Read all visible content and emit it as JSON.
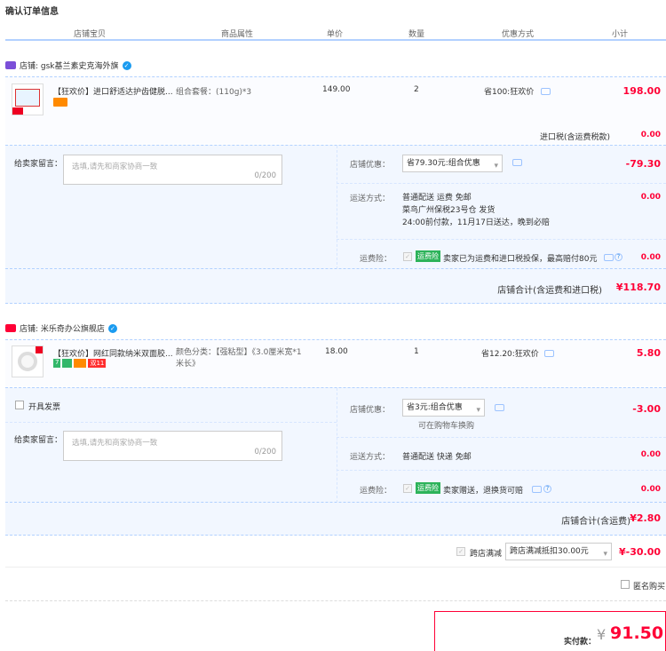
{
  "page": {
    "title": "确认订单信息"
  },
  "columns": [
    "店铺宝贝",
    "商品属性",
    "单价",
    "数量",
    "优惠方式",
    "小计"
  ],
  "shops": [
    {
      "logo": "tmall-global-badge",
      "shop_label": "店铺: gsk基兰素史克海外旗",
      "item": {
        "title": "【狂欢价】进口舒适达护齿健脱...",
        "attr": "组合套餐：(110g)*3",
        "price": "149.00",
        "qty": "2",
        "promo": "省100:狂欢价",
        "subtotal": "198.00"
      },
      "tax_label": "进口税(含运费税款)",
      "tax_value": "0.00",
      "note_label": "给卖家留言：",
      "note_placeholder": "选填,请先和商家协商一致",
      "note_count": "0/200",
      "discount_label": "店铺优惠：",
      "discount_select": "省79.30元:组合优惠",
      "discount_value": "-79.30",
      "shipping_label": "运送方式：",
      "shipping_lines": [
        "普通配送 运费 免邮",
        "菜鸟广州保税23号仓  发货",
        "24:00前付款，11月17日送达，晚到必赔"
      ],
      "shipping_value": "0.00",
      "insurance_label": "运费险：",
      "insurance_tag": "运费险",
      "insurance_text": "卖家已为运费和进口税投保，最高赔付80元",
      "insurance_value": "0.00",
      "total_label": "店铺合计(含运费和进口税)",
      "total_value": "¥118.70"
    },
    {
      "logo": "tmall-badge",
      "shop_label": "店铺: 米乐奇办公旗舰店",
      "item": {
        "title": "【狂欢价】网红同款纳米双面胶...",
        "attr_label": "颜色分类：",
        "attr": "【强粘型】《3.0厘米宽*1米长》",
        "price": "18.00",
        "qty": "1",
        "promo": "省12.20:狂欢价",
        "subtotal": "5.80",
        "tags": [
          "7",
          "双11"
        ]
      },
      "invoice_label": "开具发票",
      "note_label": "给卖家留言：",
      "note_placeholder": "选填,请先和商家协商一致",
      "note_count": "0/200",
      "discount_label": "店铺优惠：",
      "discount_select": "省3元:组合优惠",
      "discount_hint": "可在购物车换购",
      "discount_value": "-3.00",
      "shipping_label": "运送方式：",
      "shipping_lines": [
        "普通配送 快递 免邮"
      ],
      "shipping_value": "0.00",
      "insurance_label": "运费险：",
      "insurance_tag": "运费险",
      "insurance_text": "卖家赠送，退换货可赔",
      "insurance_value": "0.00",
      "total_label": "店铺合计(含运费)",
      "total_value": "¥2.80"
    }
  ],
  "cross_shop": {
    "label": "跨店满减",
    "select": "跨店满减抵扣30.00元",
    "value": "¥-30.00"
  },
  "anonymous_label": "匿名购买",
  "final": {
    "label": "实付款：",
    "currency": "¥",
    "amount": "91.50"
  },
  "colors": {
    "accent": "#ff0036",
    "border": "#b2d1ff",
    "panel": "#f2f7ff"
  }
}
